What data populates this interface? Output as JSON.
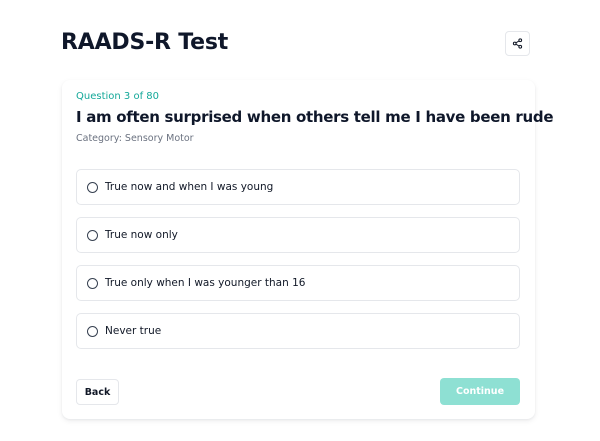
{
  "header": {
    "title": "RAADS-R Test",
    "share_icon": "share-icon"
  },
  "question": {
    "counter": "Question 3 of 80",
    "text": "I am often surprised when others tell me I have been rude",
    "category": "Category: Sensory Motor"
  },
  "options": [
    {
      "label": "True now and when I was young",
      "selected": false
    },
    {
      "label": "True now only",
      "selected": false
    },
    {
      "label": "True only when I was younger than 16",
      "selected": false
    },
    {
      "label": "Never true",
      "selected": false
    }
  ],
  "navigation": {
    "back_label": "Back",
    "continue_label": "Continue",
    "continue_enabled": false
  },
  "colors": {
    "accent": "#14a899",
    "continue_disabled_bg": "#8ee0d3",
    "title": "#0f172a",
    "muted": "#6b7280",
    "border": "#e5e7eb"
  }
}
